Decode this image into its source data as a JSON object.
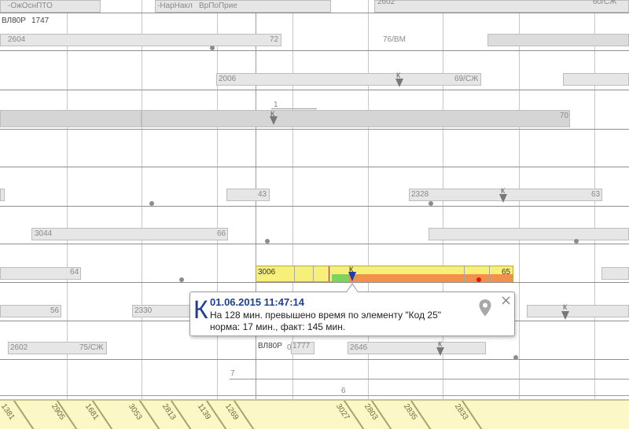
{
  "top_labels": [
    "-ОжОснПТО",
    "-НарНакл",
    "ВрПоПрие",
    "2602",
    "60/СЖ",
    "ВЛ80Р",
    "1747"
  ],
  "row_labels": {
    "r1_left": "2604",
    "r1_mid": "72",
    "r1_right": "76/ВМ",
    "r2_left": "2006",
    "r2_k": "К",
    "r2_right": "69/СЖ",
    "r3_num": "1",
    "r3_k": "К",
    "r3_right": "70",
    "r5_mid": "43",
    "r5_num": "2328",
    "r5_k": "К",
    "r5_right": "63",
    "r6_left": "3044",
    "r6_mid": "66",
    "r7_left": "64",
    "r8_left": "56",
    "r8_num": "2330",
    "r8_k": "К",
    "r9_left": "2602",
    "r9_mid": "75/СЖ",
    "r9_loco": "ВЛ80Р",
    "r9_zero": "0",
    "r9_num": "1777",
    "r9_num2": "2646",
    "r9_k": "К",
    "r10_num": "7",
    "r11_num": "6"
  },
  "active_bar": {
    "start_label": "3006",
    "end_label": "65",
    "k_label": "К"
  },
  "popup": {
    "big_letter": "К",
    "datetime": "01.06.2015 11:47:14",
    "line1": "На 128 мин. превышено время по элементу \"Код 25\"",
    "line2": "норма: 17 мин., факт: 145 мин.",
    "pin_icon": "location-pin-icon",
    "close_label": "×"
  },
  "bottom_band": {
    "labels": [
      "1381",
      "2905",
      "1681",
      "3053",
      "2813",
      "1139",
      "1269",
      "3027",
      "2803",
      "2835",
      "2833"
    ]
  },
  "colors": {
    "yellow": "#f6f07a",
    "orange": "#f2914a",
    "green": "#7fd25a",
    "marker_blue": "#1f3fa8",
    "datetime_blue": "#1f3f8f",
    "red_dot": "#e01515"
  }
}
